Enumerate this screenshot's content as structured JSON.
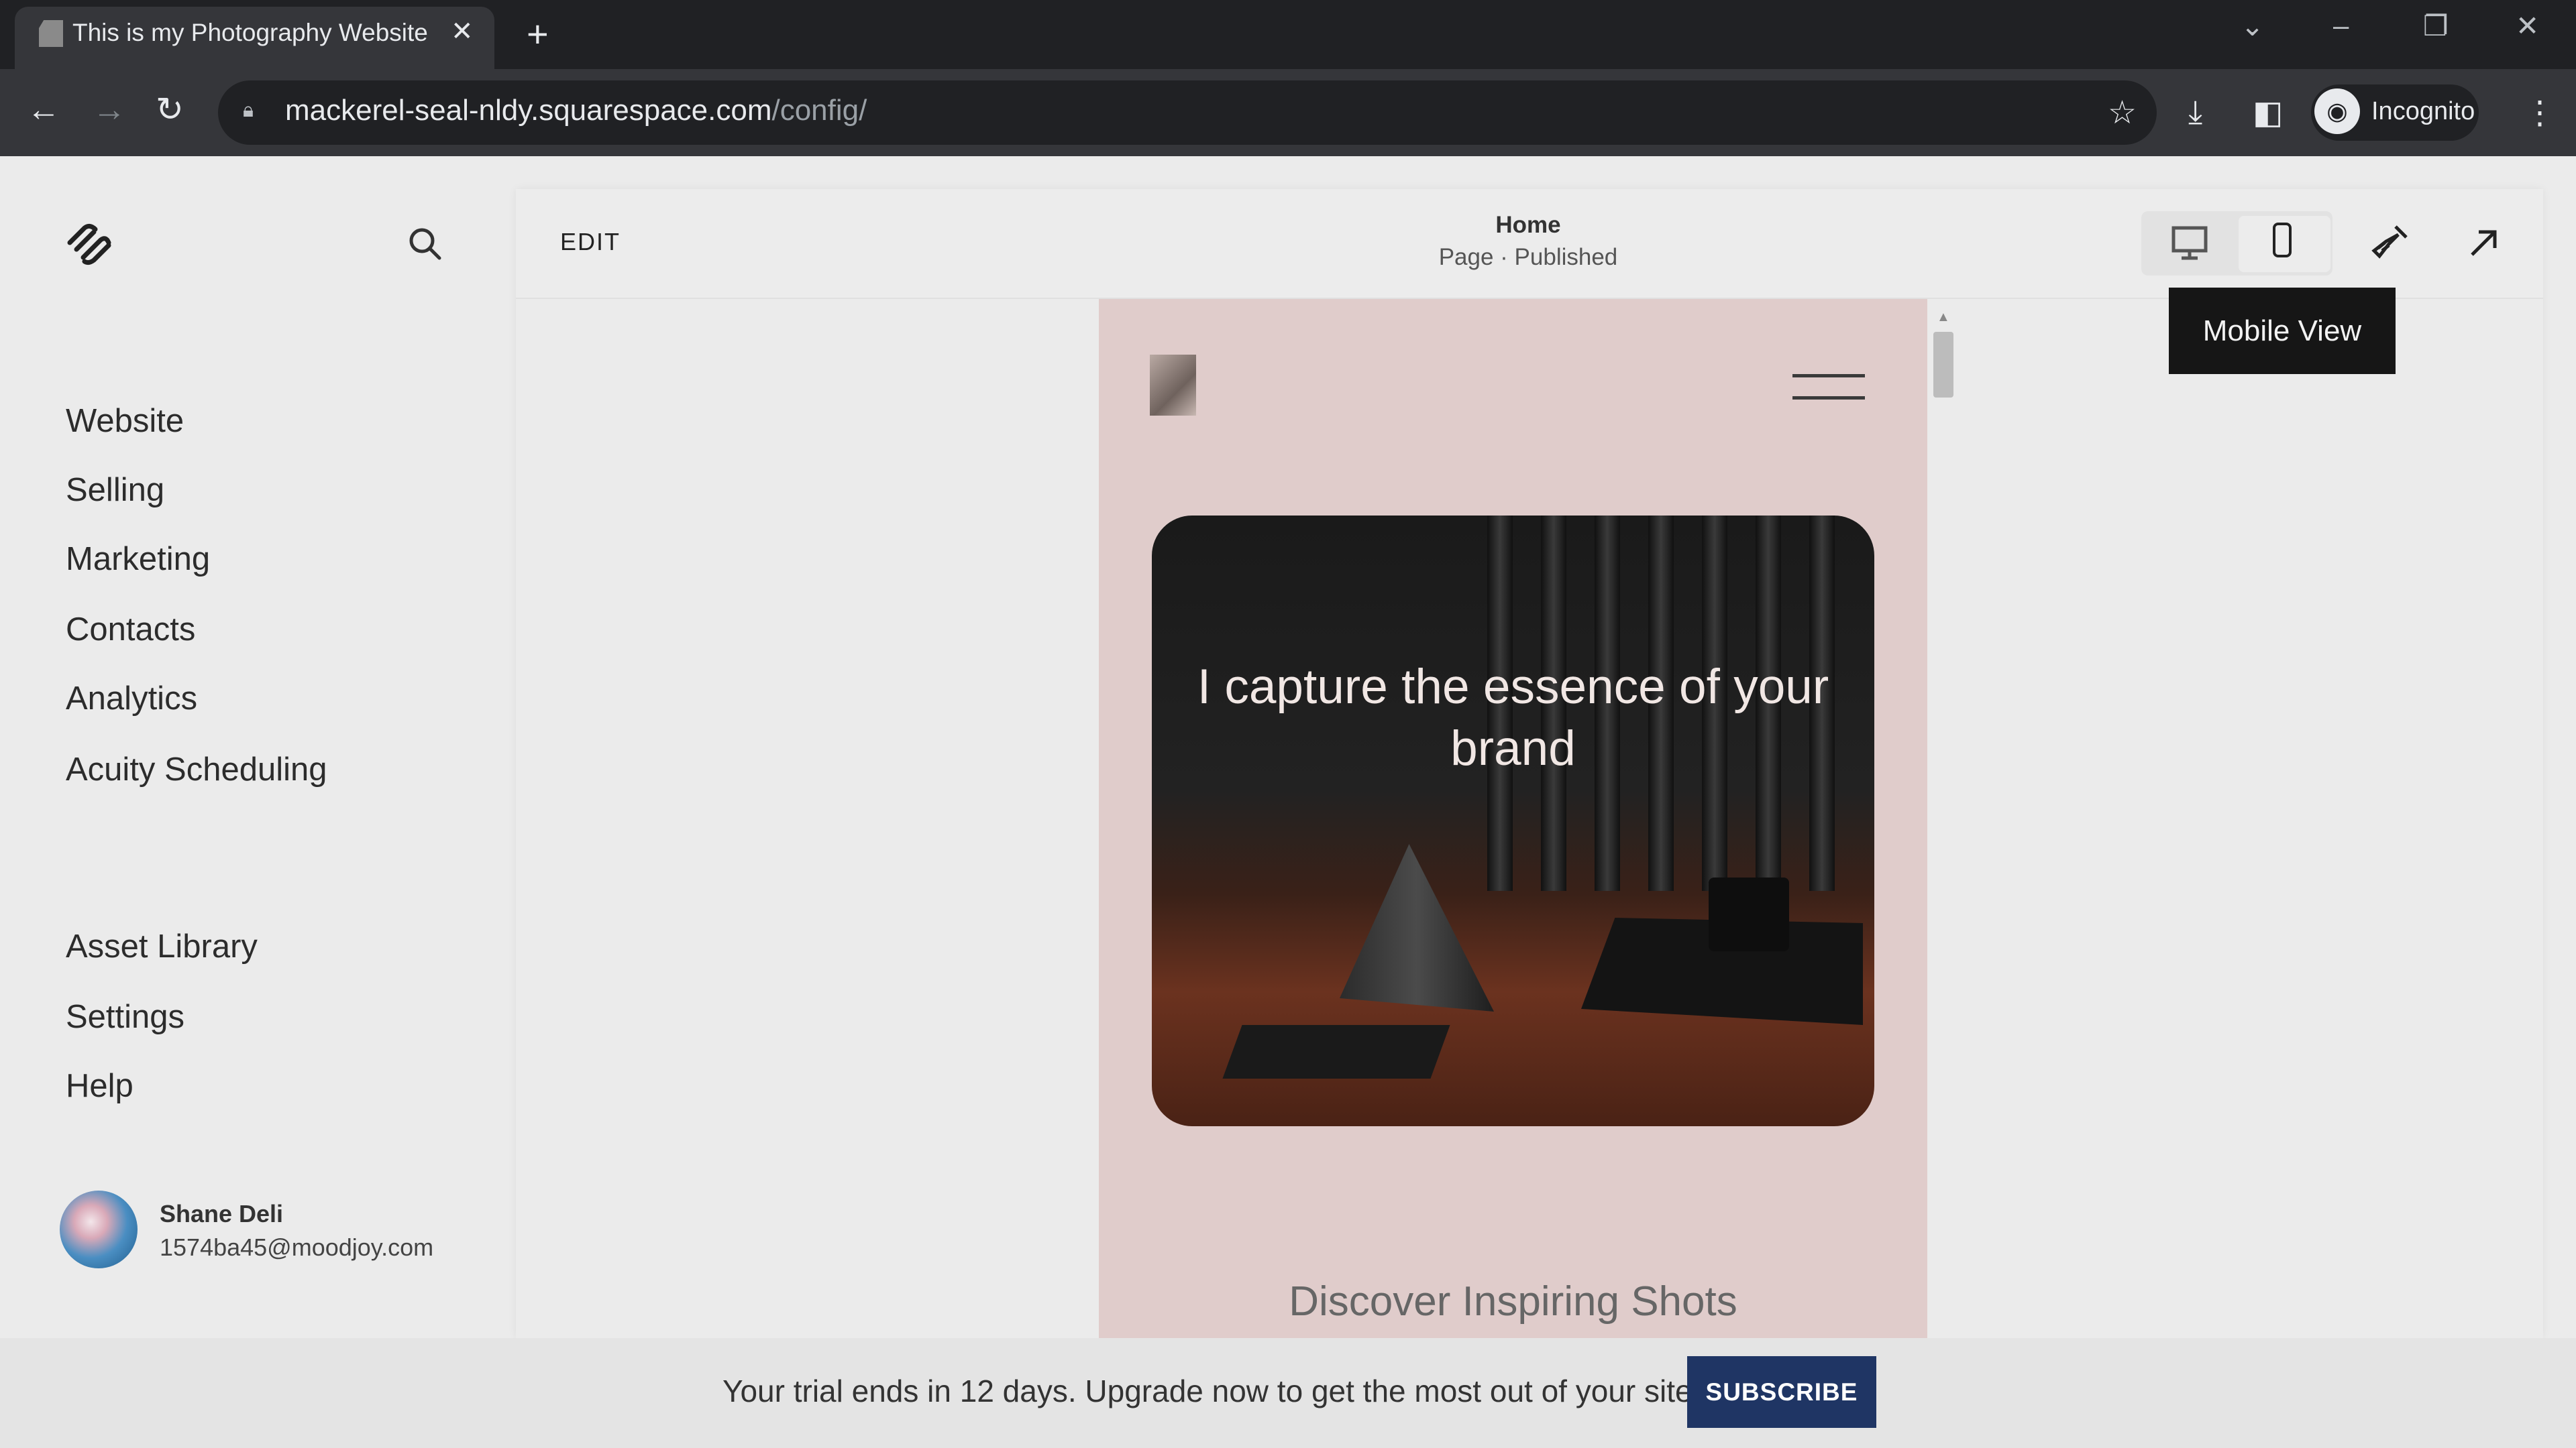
{
  "browser": {
    "tab_title": "This is my Photography Website",
    "tab_close": "✕",
    "new_tab": "+",
    "url_host": "mackerel-seal-nldy.squarespace.com",
    "url_path": "/config/",
    "profile_label": "Incognito",
    "controls": {
      "tab_search": "⌄",
      "minimize": "–",
      "restore": "❐",
      "close": "✕"
    },
    "nav": {
      "back": "←",
      "forward": "→",
      "reload": "↻",
      "star": "☆",
      "download": "⤓",
      "sidepanel": "◧",
      "menu": "⋮"
    }
  },
  "sidebar": {
    "items": [
      {
        "label": "Website"
      },
      {
        "label": "Selling"
      },
      {
        "label": "Marketing"
      },
      {
        "label": "Contacts"
      },
      {
        "label": "Analytics"
      },
      {
        "label": "Acuity Scheduling"
      }
    ],
    "secondary": [
      {
        "label": "Asset Library"
      },
      {
        "label": "Settings"
      },
      {
        "label": "Help"
      }
    ],
    "user": {
      "name": "Shane Deli",
      "email": "1574ba45@moodjoy.com"
    }
  },
  "editor": {
    "edit_label": "EDIT",
    "page_title": "Home",
    "page_status": "Page · Published",
    "tooltip": "Mobile View"
  },
  "preview": {
    "hero_text": "I capture the essence of your brand",
    "section_title": "Discover Inspiring Shots"
  },
  "banner": {
    "message": "Your trial ends in 12 days. Upgrade now to get the most out of your site.",
    "subscribe_label": "SUBSCRIBE",
    "button_color": "#1f3564"
  }
}
